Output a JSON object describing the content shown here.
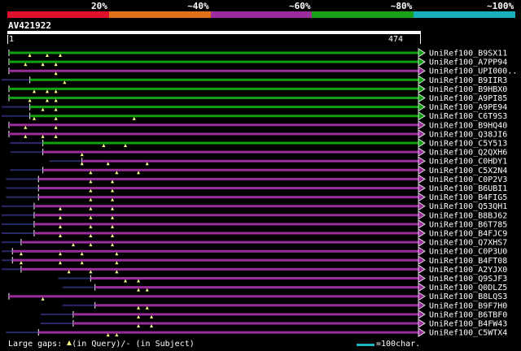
{
  "legend": [
    {
      "label": "20%",
      "color": "#e0102c"
    },
    {
      "label": "~40%",
      "color": "#e07018"
    },
    {
      "label": "~60%",
      "color": "#9a2c9c"
    },
    {
      "label": "~80%",
      "color": "#18a018"
    },
    {
      "label": "~100%",
      "color": "#18b0bc"
    }
  ],
  "query": {
    "id": "AV421922",
    "start": "1",
    "end": "474",
    "length": 474
  },
  "footer": {
    "gaps_prefix": "Large gaps: ",
    "gaps_query": "(in Query)/- (in Subject)",
    "scale_label": "=100char."
  },
  "hits": [
    {
      "name": "UniRef100_B9SX11",
      "start": 1,
      "end": 474,
      "color": "green",
      "gaps": [
        25,
        45,
        60
      ]
    },
    {
      "name": "UniRef100_A7PP94",
      "start": 1,
      "end": 474,
      "color": "green",
      "gaps": [
        20,
        40,
        55
      ]
    },
    {
      "name": "UniRef100_UPI000..",
      "start": 1,
      "end": 474,
      "color": "purple",
      "gaps": [
        55
      ]
    },
    {
      "name": "UniRef100_B9IIR3",
      "start": 25,
      "end": 474,
      "color": "green",
      "gaps": [
        65
      ]
    },
    {
      "name": "UniRef100_B9HBX0",
      "start": 1,
      "end": 474,
      "color": "green",
      "gaps": [
        30,
        45,
        55
      ]
    },
    {
      "name": "UniRef100_A9PI85",
      "start": 1,
      "end": 474,
      "color": "green",
      "gaps": [
        25,
        45,
        55
      ]
    },
    {
      "name": "UniRef100_A9PE94",
      "start": 25,
      "end": 474,
      "color": "green",
      "gaps": [
        40,
        55
      ]
    },
    {
      "name": "UniRef100_C6T9S3",
      "start": 25,
      "end": 474,
      "color": "green",
      "gaps": [
        30,
        55,
        145
      ]
    },
    {
      "name": "UniRef100_B9HQ40",
      "start": 1,
      "end": 474,
      "color": "purple",
      "gaps": [
        20,
        55
      ]
    },
    {
      "name": "UniRef100_Q38JI6",
      "start": 1,
      "end": 474,
      "color": "purple",
      "gaps": [
        20,
        40,
        55
      ]
    },
    {
      "name": "UniRef100_C5Y513",
      "start": 40,
      "end": 474,
      "color": "green",
      "gaps": [
        110,
        135
      ]
    },
    {
      "name": "UniRef100_Q2QXH6",
      "start": 40,
      "end": 474,
      "color": "purple",
      "gaps": [
        85
      ]
    },
    {
      "name": "UniRef100_C0HDY1",
      "start": 85,
      "end": 474,
      "color": "purple",
      "gaps": [
        85,
        115,
        160
      ]
    },
    {
      "name": "UniRef100_C5X2N4",
      "start": 40,
      "end": 474,
      "color": "purple",
      "gaps": [
        95,
        125,
        150
      ]
    },
    {
      "name": "UniRef100_C0P2V3",
      "start": 35,
      "end": 474,
      "color": "purple",
      "gaps": [
        95,
        120
      ]
    },
    {
      "name": "UniRef100_B6UBI1",
      "start": 35,
      "end": 474,
      "color": "purple",
      "gaps": [
        95,
        120
      ]
    },
    {
      "name": "UniRef100_B4FIG5",
      "start": 35,
      "end": 474,
      "color": "purple",
      "gaps": [
        95,
        120
      ]
    },
    {
      "name": "UniRef100_Q53QH1",
      "start": 30,
      "end": 474,
      "color": "purple",
      "gaps": [
        60,
        95,
        120
      ]
    },
    {
      "name": "UniRef100_B8BJ62",
      "start": 30,
      "end": 474,
      "color": "purple",
      "gaps": [
        60,
        95,
        120
      ]
    },
    {
      "name": "UniRef100_B6T785",
      "start": 30,
      "end": 474,
      "color": "purple",
      "gaps": [
        60,
        95,
        120
      ]
    },
    {
      "name": "UniRef100_B4FJC9",
      "start": 30,
      "end": 474,
      "color": "purple",
      "gaps": [
        60,
        95,
        120
      ]
    },
    {
      "name": "UniRef100_Q7XHS7",
      "start": 15,
      "end": 474,
      "color": "purple",
      "gaps": [
        75,
        95,
        120
      ]
    },
    {
      "name": "UniRef100_C0P3U0",
      "start": 5,
      "end": 474,
      "color": "purple",
      "gaps": [
        15,
        60,
        85,
        125
      ]
    },
    {
      "name": "UniRef100_B4FT08",
      "start": 5,
      "end": 474,
      "color": "purple",
      "gaps": [
        15,
        60,
        85,
        125
      ]
    },
    {
      "name": "UniRef100_A2YJX0",
      "start": 15,
      "end": 474,
      "color": "purple",
      "gaps": [
        70,
        95,
        125
      ]
    },
    {
      "name": "UniRef100_Q9SJF3",
      "start": 95,
      "end": 474,
      "color": "purple",
      "gaps": [
        135,
        150
      ]
    },
    {
      "name": "UniRef100_Q0DLZ5",
      "start": 100,
      "end": 474,
      "color": "purple",
      "gaps": [
        150,
        160
      ]
    },
    {
      "name": "UniRef100_B8LQS3",
      "start": 1,
      "end": 474,
      "color": "purple",
      "gaps": [
        40
      ]
    },
    {
      "name": "UniRef100_B9F7H0",
      "start": 100,
      "end": 474,
      "color": "purple",
      "gaps": [
        150,
        160
      ]
    },
    {
      "name": "UniRef100_B6TBF0",
      "start": 75,
      "end": 474,
      "color": "purple",
      "gaps": [
        150,
        165
      ]
    },
    {
      "name": "UniRef100_B4FW43",
      "start": 75,
      "end": 474,
      "color": "purple",
      "gaps": [
        150,
        165
      ]
    },
    {
      "name": "UniRef100_C5WTX4",
      "start": 35,
      "end": 474,
      "color": "purple",
      "gaps": [
        115,
        125
      ]
    }
  ],
  "colors": {
    "green": "#10a010",
    "purple": "#9a2c9c",
    "gap": "#ffff90",
    "dim": "#2a2a6a"
  }
}
